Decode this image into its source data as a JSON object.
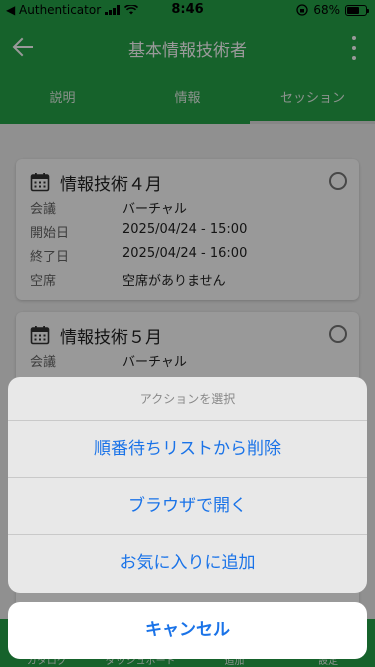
{
  "status_bar": {
    "back_app": "◀ Authenticator",
    "time": "8:46",
    "battery_percent": "68%",
    "battery_level": 0.68
  },
  "app_bar": {
    "title": "基本情報技術者"
  },
  "tabs": [
    {
      "label": "説明",
      "active": false
    },
    {
      "label": "情報",
      "active": false
    },
    {
      "label": "セッション",
      "active": true
    }
  ],
  "sessions": [
    {
      "title": "情報技術４月",
      "rows": [
        {
          "key": "会議",
          "value": "バーチャル"
        },
        {
          "key": "開始日",
          "value": "2025/04/24 - 15:00"
        },
        {
          "key": "終了日",
          "value": "2025/04/24 - 16:00"
        },
        {
          "key": "空席",
          "value": "空席がありません"
        }
      ]
    },
    {
      "title": "情報技術５月",
      "rows": [
        {
          "key": "会議",
          "value": "バーチャル"
        }
      ]
    }
  ],
  "bottom_nav": [
    "カタログ",
    "ダッシュボード",
    "追加",
    "設定"
  ],
  "action_sheet": {
    "title": "アクションを選択",
    "actions": [
      "順番待ちリストから削除",
      "ブラウザで開く",
      "お気に入りに追加"
    ],
    "cancel": "キャンセル"
  },
  "colors": {
    "brand_green": "#25a449",
    "action_blue": "#1a73e8"
  }
}
